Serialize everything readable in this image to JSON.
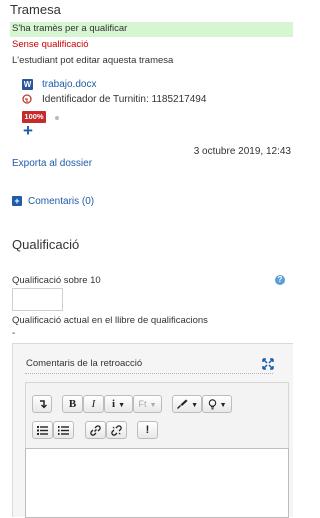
{
  "submission": {
    "heading": "Tramesa",
    "status": "S'ha tramès per a qualificar",
    "grading_status": "Sense qualificació",
    "note": "L'estudiant pot editar aquesta tramesa",
    "file_name": "trabajo.docx",
    "turnitin_id": "Identificador de Turnitin: 1185217494",
    "similarity": "100%",
    "date": "3 octubre 2019, 12:43",
    "export_link": "Exporta al dossier",
    "comments_link": "Comentaris (0)"
  },
  "grade": {
    "heading": "Qualificació",
    "label": "Qualificació sobre 10",
    "value": "",
    "current_label": "Qualificació actual en el llibre de qualificacions",
    "current_value": "-"
  },
  "feedback": {
    "title": "Comentaris de la retroacció",
    "bold_label": "B",
    "italic_label": "I",
    "info_label": "i",
    "font_size_label": "Ft"
  },
  "colors": {
    "accent": "#1d5ca8",
    "status_green": "#d6f5d1",
    "alert_red": "#cc0000",
    "badge_red": "#c62b2b"
  }
}
